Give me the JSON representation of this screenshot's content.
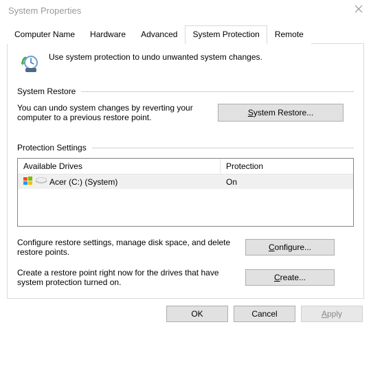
{
  "window_title": "System Properties",
  "tabs": [
    "Computer Name",
    "Hardware",
    "Advanced",
    "System Protection",
    "Remote"
  ],
  "intro_text": "Use system protection to undo unwanted system changes.",
  "section_restore_title": "System Restore",
  "restore_text": "You can undo system changes by reverting your computer to a previous restore point.",
  "restore_btn_prefix": "S",
  "restore_btn_rest": "ystem Restore...",
  "section_settings_title": "Protection Settings",
  "col_drive": "Available Drives",
  "col_protection": "Protection",
  "drive_name": "Acer (C:) (System)",
  "drive_status": "On",
  "config_text": "Configure restore settings, manage disk space, and delete restore points.",
  "configure_btn_prefix": "C",
  "configure_btn_rest": "onfigure...",
  "create_text": "Create a restore point right now for the drives that have system protection turned on.",
  "create_btn_prefix": "C",
  "create_btn_rest": "reate...",
  "ok_label": "OK",
  "cancel_label": "Cancel",
  "apply_prefix": "A",
  "apply_rest": "pply"
}
